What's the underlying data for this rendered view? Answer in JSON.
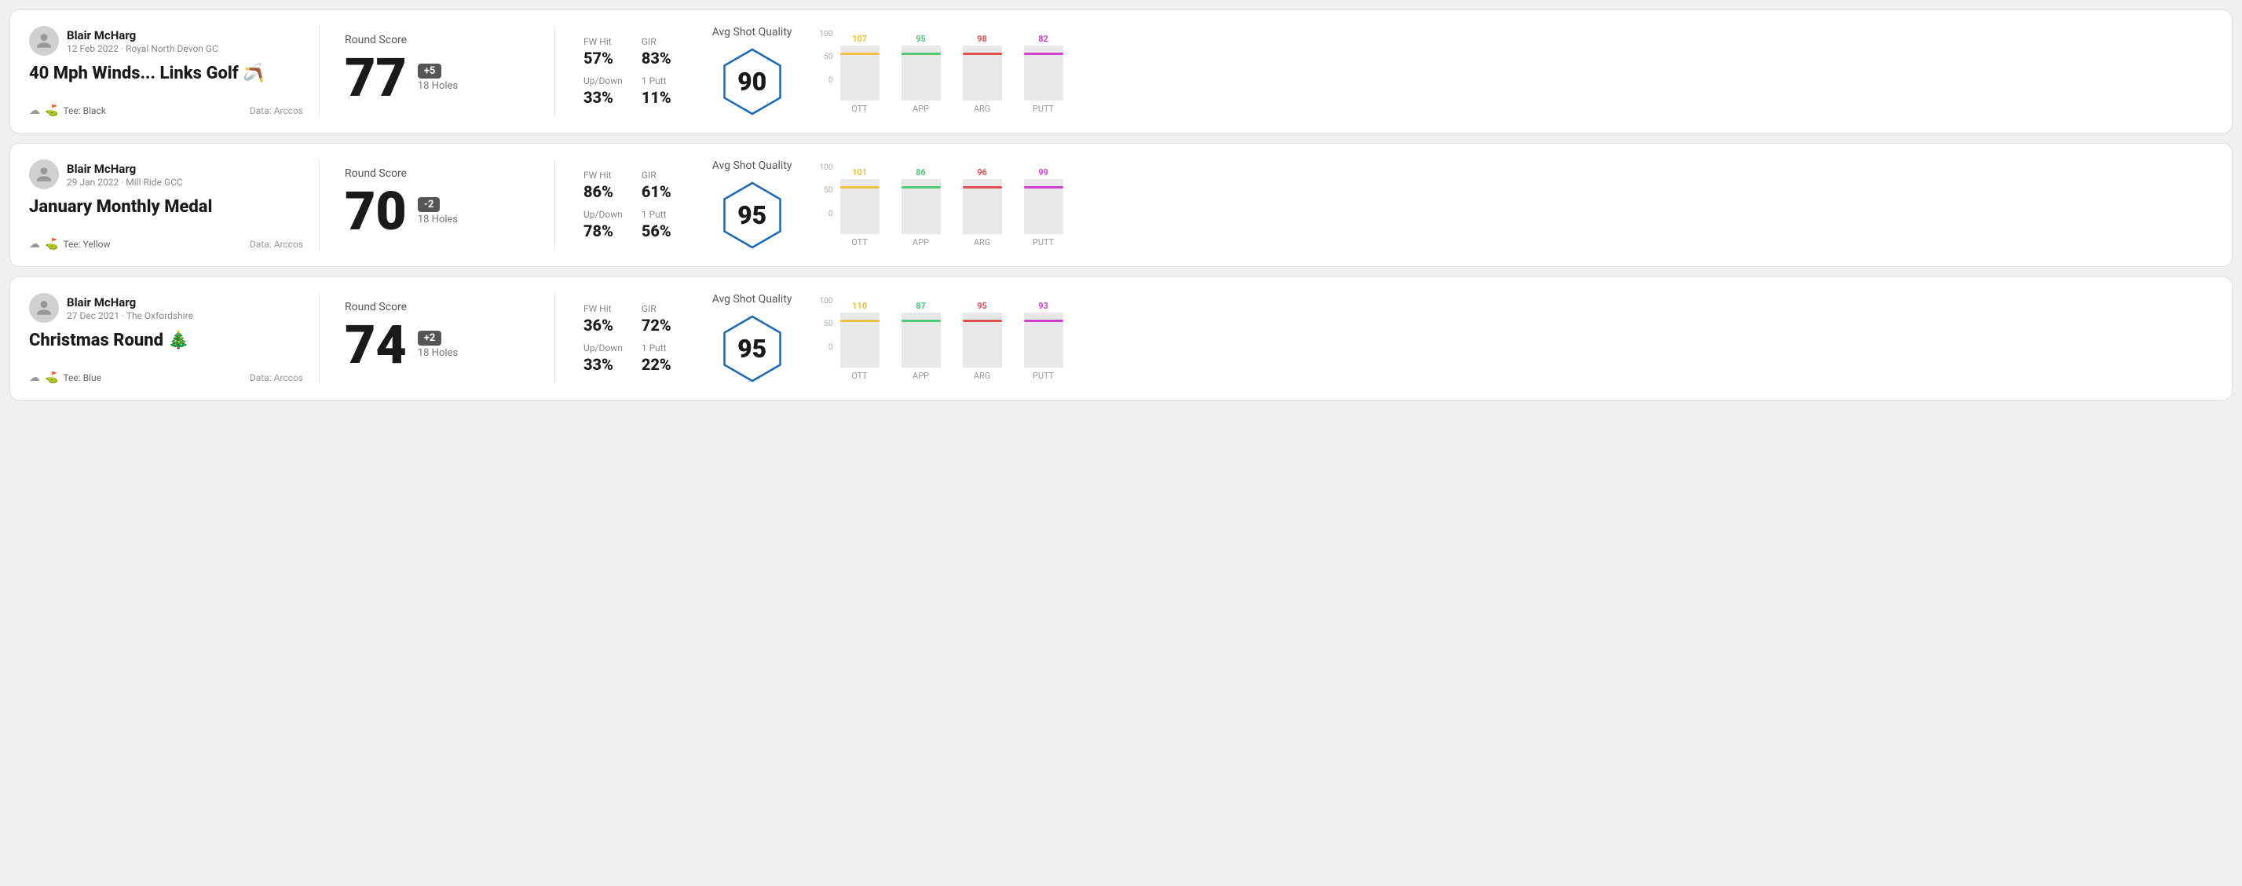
{
  "rounds": [
    {
      "id": "round1",
      "player": {
        "name": "Blair McHarg",
        "date": "12 Feb 2022 · Royal North Devon GC"
      },
      "title": "40 Mph Winds... Links Golf 🪃",
      "tee": "Black",
      "data_source": "Data: Arccos",
      "round_score_label": "Round Score",
      "score": 77,
      "score_diff": "+5",
      "score_diff_type": "positive",
      "holes": "18 Holes",
      "fw_hit": "57%",
      "gir": "83%",
      "up_down": "33%",
      "one_putt": "11%",
      "avg_shot_quality_label": "Avg Shot Quality",
      "avg_shot_quality": 90,
      "chart": {
        "bars": [
          {
            "label": "OTT",
            "value": 107,
            "color": "#f0c040",
            "max": 120
          },
          {
            "label": "APP",
            "value": 95,
            "color": "#50c878",
            "max": 120
          },
          {
            "label": "ARG",
            "value": 98,
            "color": "#e05050",
            "max": 120
          },
          {
            "label": "PUTT",
            "value": 82,
            "color": "#d040d0",
            "max": 120
          }
        ],
        "y_labels": [
          "100",
          "50",
          "0"
        ]
      }
    },
    {
      "id": "round2",
      "player": {
        "name": "Blair McHarg",
        "date": "29 Jan 2022 · Mill Ride GCC"
      },
      "title": "January Monthly Medal",
      "tee": "Yellow",
      "data_source": "Data: Arccos",
      "round_score_label": "Round Score",
      "score": 70,
      "score_diff": "-2",
      "score_diff_type": "negative",
      "holes": "18 Holes",
      "fw_hit": "86%",
      "gir": "61%",
      "up_down": "78%",
      "one_putt": "56%",
      "avg_shot_quality_label": "Avg Shot Quality",
      "avg_shot_quality": 95,
      "chart": {
        "bars": [
          {
            "label": "OTT",
            "value": 101,
            "color": "#f0c040",
            "max": 120
          },
          {
            "label": "APP",
            "value": 86,
            "color": "#50c878",
            "max": 120
          },
          {
            "label": "ARG",
            "value": 96,
            "color": "#e05050",
            "max": 120
          },
          {
            "label": "PUTT",
            "value": 99,
            "color": "#d040d0",
            "max": 120
          }
        ],
        "y_labels": [
          "100",
          "50",
          "0"
        ]
      }
    },
    {
      "id": "round3",
      "player": {
        "name": "Blair McHarg",
        "date": "27 Dec 2021 · The Oxfordshire"
      },
      "title": "Christmas Round 🎄",
      "tee": "Blue",
      "data_source": "Data: Arccos",
      "round_score_label": "Round Score",
      "score": 74,
      "score_diff": "+2",
      "score_diff_type": "positive",
      "holes": "18 Holes",
      "fw_hit": "36%",
      "gir": "72%",
      "up_down": "33%",
      "one_putt": "22%",
      "avg_shot_quality_label": "Avg Shot Quality",
      "avg_shot_quality": 95,
      "chart": {
        "bars": [
          {
            "label": "OTT",
            "value": 110,
            "color": "#f0c040",
            "max": 120
          },
          {
            "label": "APP",
            "value": 87,
            "color": "#50c878",
            "max": 120
          },
          {
            "label": "ARG",
            "value": 95,
            "color": "#e05050",
            "max": 120
          },
          {
            "label": "PUTT",
            "value": 93,
            "color": "#d040d0",
            "max": 120
          }
        ],
        "y_labels": [
          "100",
          "50",
          "0"
        ]
      }
    }
  ],
  "labels": {
    "fw_hit": "FW Hit",
    "gir": "GIR",
    "up_down": "Up/Down",
    "one_putt": "1 Putt",
    "tee_prefix": "Tee:"
  }
}
